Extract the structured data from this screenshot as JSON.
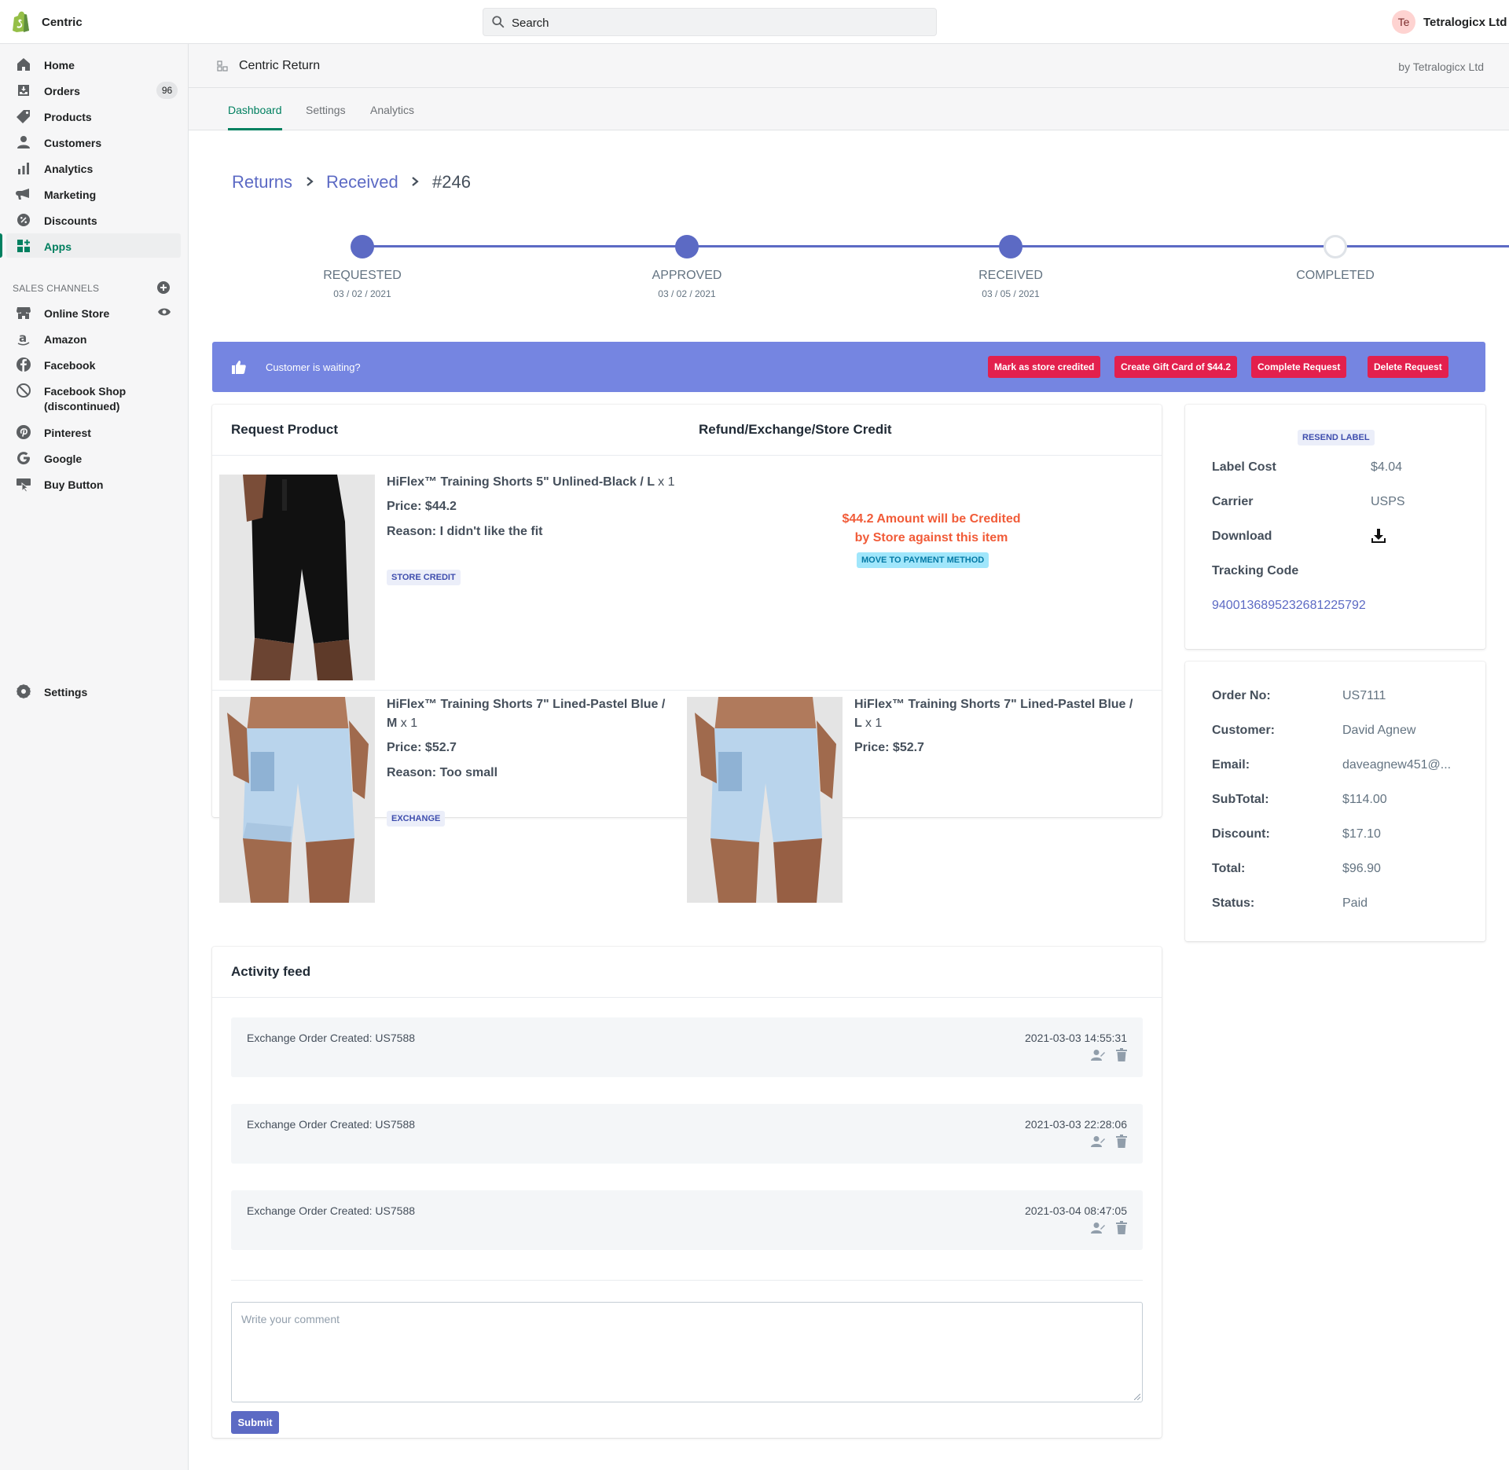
{
  "topbar": {
    "store_name": "Centric",
    "search_placeholder": "Search",
    "avatar_initials": "Te",
    "user_name": "Tetralogicx Ltd"
  },
  "sidebar": {
    "items": [
      {
        "label": "Home",
        "icon": "home-icon"
      },
      {
        "label": "Orders",
        "icon": "orders-icon",
        "badge": "96"
      },
      {
        "label": "Products",
        "icon": "tag-icon"
      },
      {
        "label": "Customers",
        "icon": "person-icon"
      },
      {
        "label": "Analytics",
        "icon": "bar-chart-icon"
      },
      {
        "label": "Marketing",
        "icon": "megaphone-icon"
      },
      {
        "label": "Discounts",
        "icon": "discount-icon"
      },
      {
        "label": "Apps",
        "icon": "apps-icon",
        "active": true
      }
    ],
    "sales_channels_heading": "SALES CHANNELS",
    "channels": [
      {
        "label": "Online Store",
        "icon": "store-icon"
      },
      {
        "label": "Amazon",
        "icon": "amazon-icon"
      },
      {
        "label": "Facebook",
        "icon": "facebook-icon"
      },
      {
        "label": "Facebook Shop",
        "label2": "(discontinued)",
        "icon": "blocked-icon"
      },
      {
        "label": "Pinterest",
        "icon": "pinterest-icon"
      },
      {
        "label": "Google",
        "icon": "google-icon"
      },
      {
        "label": "Buy Button",
        "icon": "buy-button-icon"
      }
    ],
    "settings_label": "Settings"
  },
  "app_header": {
    "title": "Centric Return",
    "by": "by Tetralogicx Ltd"
  },
  "tabs": [
    "Dashboard",
    "Settings",
    "Analytics"
  ],
  "breadcrumb": {
    "returns": "Returns",
    "received": "Received",
    "current": "#246"
  },
  "progress": {
    "steps": [
      {
        "label": "REQUESTED",
        "date": "03 / 02 / 2021",
        "done": true
      },
      {
        "label": "APPROVED",
        "date": "03 / 02 / 2021",
        "done": true
      },
      {
        "label": "RECEIVED",
        "date": "03 / 05 / 2021",
        "done": true
      },
      {
        "label": "COMPLETED",
        "date": "",
        "done": false
      }
    ]
  },
  "banner": {
    "text": "Customer is waiting?",
    "buttons": [
      "Mark as store credited",
      "Create Gift Card of $44.2",
      "Complete Request",
      "Delete Request"
    ]
  },
  "products_card": {
    "col1_heading": "Request Product",
    "col2_heading": "Refund/Exchange/Store Credit",
    "row1": {
      "title": "HiFlex™ Training Shorts 5\" Unlined-Black / L",
      "qty": "x 1",
      "price": "Price: $44.2",
      "reason": "Reason: I didn't like the fit",
      "tag": "STORE CREDIT",
      "credit_line1": "$44.2 Amount will be Credited",
      "credit_line2": "by Store against this item",
      "move_tag": "MOVE TO PAYMENT METHOD"
    },
    "row2": {
      "title_line1": "HiFlex™ Training Shorts 7\" Lined-Pastel Blue /",
      "title_line2": "M",
      "qty": "x 1",
      "price": "Price: $52.7",
      "reason": "Reason: Too small",
      "tag": "EXCHANGE",
      "exchange_title_line1": "HiFlex™ Training Shorts 7\" Lined-Pastel Blue /",
      "exchange_title_line2": "L",
      "exchange_qty": "x 1",
      "exchange_price": "Price: $52.7"
    }
  },
  "label_card": {
    "resend": "RESEND LABEL",
    "label_cost_label": "Label Cost",
    "label_cost": "$4.04",
    "carrier_label": "Carrier",
    "carrier": "USPS",
    "download_label": "Download",
    "tracking_label": "Tracking Code",
    "tracking_code": "9400136895232681225792"
  },
  "order_card": {
    "order_no_label": "Order No:",
    "order_no": "US7111",
    "customer_label": "Customer:",
    "customer": "David Agnew",
    "email_label": "Email:",
    "email": "daveagnew451@...",
    "subtotal_label": "SubTotal:",
    "subtotal": "$114.00",
    "discount_label": "Discount:",
    "discount": "$17.10",
    "total_label": "Total:",
    "total": "$96.90",
    "status_label": "Status:",
    "status": "Paid"
  },
  "activity": {
    "heading": "Activity feed",
    "items": [
      {
        "text": "Exchange Order Created: US7588",
        "time": "2021-03-03 14:55:31"
      },
      {
        "text": "Exchange Order Created: US7588",
        "time": "2021-03-03 22:28:06"
      },
      {
        "text": "Exchange Order Created: US7588",
        "time": "2021-03-04 08:47:05"
      }
    ],
    "comment_placeholder": "Write your comment",
    "submit": "Submit"
  },
  "colors": {
    "accent": "#5c6ac4",
    "banner": "#7585e1",
    "danger": "#e3204d",
    "shopify_green": "#008060",
    "credit_text": "#f15b38"
  }
}
